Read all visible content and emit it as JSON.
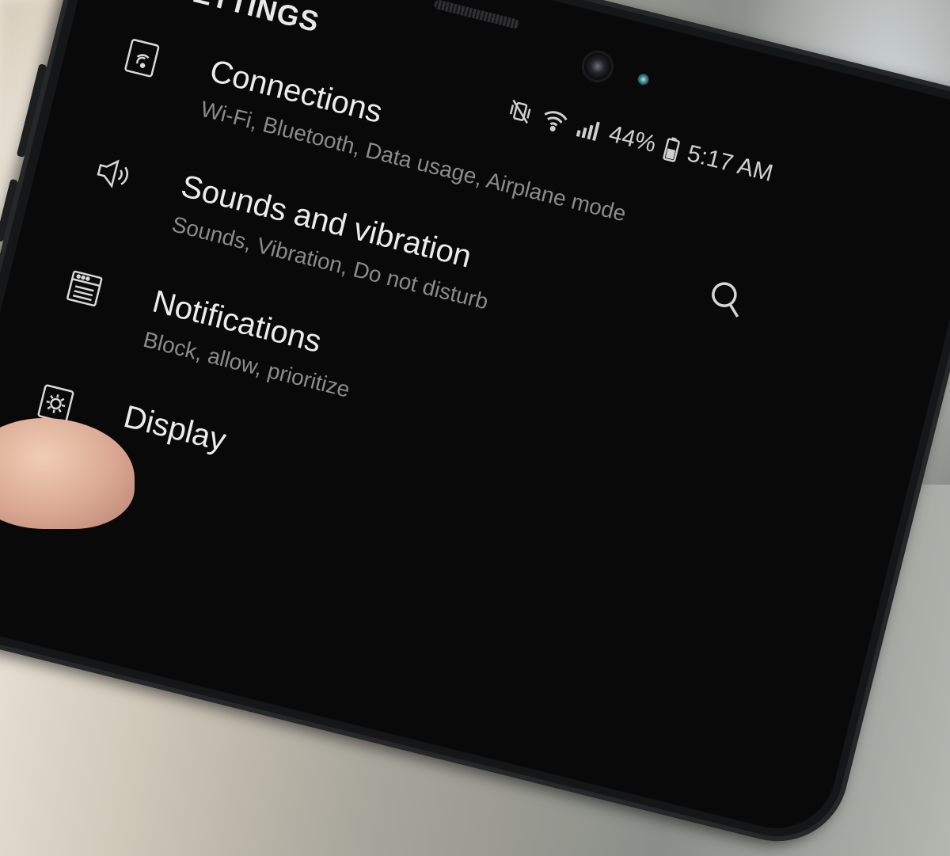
{
  "screen": {
    "title": "SETTINGS"
  },
  "status_bar": {
    "battery_percent": "44%",
    "time": "5:17 AM",
    "icons": [
      "mute-vibrate-icon",
      "wifi-icon",
      "signal-icon",
      "battery-icon"
    ]
  },
  "header": {
    "search_icon": "search-icon"
  },
  "menu": {
    "items": [
      {
        "icon": "connections-icon",
        "label": "Connections",
        "subtitle": "Wi-Fi, Bluetooth, Data usage, Airplane mode"
      },
      {
        "icon": "speaker-icon",
        "label": "Sounds and vibration",
        "subtitle": "Sounds, Vibration, Do not disturb"
      },
      {
        "icon": "notifications-icon",
        "label": "Notifications",
        "subtitle": "Block, allow, prioritize"
      },
      {
        "icon": "display-icon",
        "label": "Display",
        "subtitle": ""
      }
    ]
  },
  "colors": {
    "screen_background": "#090909",
    "primary_text": "#ececec",
    "secondary_text": "#8b8b8b",
    "phone_frame": "#151618"
  }
}
